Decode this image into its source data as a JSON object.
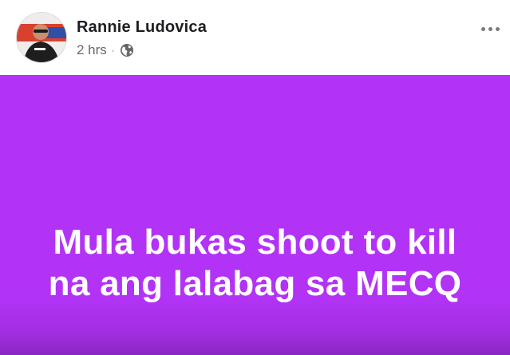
{
  "post": {
    "author": "Rannie Ludovica",
    "time": "2 hrs",
    "separator": "·",
    "audience_icon": "globe-icon",
    "more_icon": "more-options-icon",
    "text_lines": [
      "Mula bukas shoot to kill",
      "na ang lalabag sa MECQ"
    ],
    "background_color": "#b233f6",
    "text_color": "#ffffff"
  }
}
